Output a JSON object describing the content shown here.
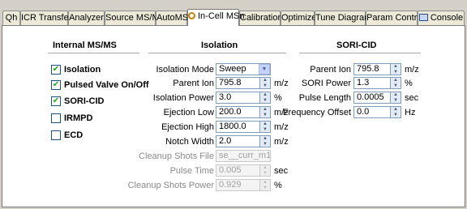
{
  "tabs": [
    {
      "label": "Qh",
      "active": false,
      "icon": ""
    },
    {
      "label": "ICR Transfer",
      "active": false,
      "icon": ""
    },
    {
      "label": "Analyzer",
      "active": false,
      "icon": ""
    },
    {
      "label": "Source MS/MS",
      "active": false,
      "icon": ""
    },
    {
      "label": "AutoMS",
      "active": false,
      "icon": ""
    },
    {
      "label": "In-Cell MSn",
      "active": true,
      "icon": "radio-icon"
    },
    {
      "label": "Calibration",
      "active": false,
      "icon": ""
    },
    {
      "label": "Optimize",
      "active": false,
      "icon": ""
    },
    {
      "label": "Tune Diagram",
      "active": false,
      "icon": ""
    },
    {
      "label": "Param Control",
      "active": false,
      "icon": ""
    },
    {
      "label": "Console",
      "active": false,
      "icon": "console-icon"
    }
  ],
  "internal_msms": {
    "title": "Internal MS/MS",
    "options": [
      {
        "label": "Isolation",
        "checked": true
      },
      {
        "label": "Pulsed Valve On/Off",
        "checked": true
      },
      {
        "label": "SORI-CID",
        "checked": true
      },
      {
        "label": "IRMPD",
        "checked": false
      },
      {
        "label": "ECD",
        "checked": false
      }
    ]
  },
  "isolation": {
    "title": "Isolation",
    "mode": {
      "label": "Isolation Mode",
      "value": "Sweep"
    },
    "fields": [
      {
        "label": "Parent Ion",
        "value": "795.8",
        "unit": "m/z",
        "enabled": true
      },
      {
        "label": "Isolation Power",
        "value": "3.0",
        "unit": "%",
        "enabled": true
      },
      {
        "label": "Ejection Low",
        "value": "200.0",
        "unit": "m/z",
        "enabled": true
      },
      {
        "label": "Ejection High",
        "value": "1800.0",
        "unit": "m/z",
        "enabled": true
      },
      {
        "label": "Notch Width",
        "value": "2.0",
        "unit": "m/z",
        "enabled": true
      }
    ],
    "cleanup_file": {
      "label": "Cleanup Shots File",
      "value": "se__curr_m1"
    },
    "disabled_fields": [
      {
        "label": "Pulse Time",
        "value": "0.005",
        "unit": "sec"
      },
      {
        "label": "Cleanup Shots Power",
        "value": "0.929",
        "unit": "%"
      }
    ]
  },
  "sori_cid": {
    "title": "SORI-CID",
    "fields": [
      {
        "label": "Parent Ion",
        "value": "795.8",
        "unit": "m/z"
      },
      {
        "label": "SORI Power",
        "value": "1.3",
        "unit": "%"
      },
      {
        "label": "Pulse Length",
        "value": "0.0005",
        "unit": "sec"
      },
      {
        "label": "Frequency Offset",
        "value": "0.0",
        "unit": "Hz"
      }
    ]
  },
  "colors": {
    "check": "#21a121",
    "field_border": "#7f9db9",
    "active_tab_icon": "#c58000"
  }
}
